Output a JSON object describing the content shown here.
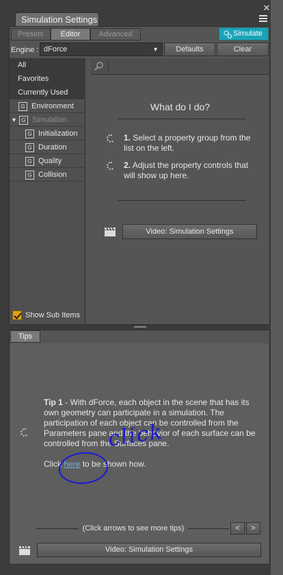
{
  "window": {
    "title": "Simulation Settings"
  },
  "tabs": [
    {
      "label": "Presets"
    },
    {
      "label": "Editor"
    },
    {
      "label": "Advanced"
    }
  ],
  "simulate_button": {
    "label": "Simulate"
  },
  "engine": {
    "label": "Engine :",
    "value": "dForce"
  },
  "buttons": {
    "defaults": "Defaults",
    "clear": "Clear"
  },
  "tree": {
    "all": "All",
    "favorites": "Favorites",
    "currently_used": "Currently Used",
    "items": [
      {
        "label": "Environment"
      },
      {
        "label": "Simulation"
      },
      {
        "label": "Initialization"
      },
      {
        "label": "Duration"
      },
      {
        "label": "Quality"
      },
      {
        "label": "Collision"
      }
    ],
    "show_sub_items": "Show Sub Items"
  },
  "help": {
    "heading": "What do I do?",
    "step1_num": "1.",
    "step1_text": "Select a property group from the list on the left.",
    "step2_num": "2.",
    "step2_text": "Adjust the property controls that will show up here.",
    "video_button": "Video: Simulation Settings"
  },
  "tips": {
    "tab_label": "Tips",
    "tip_title": "Tip 1",
    "tip_body": " - With dForce, each object in the scene that has its own geometry can participate in a simulation. The participation of each object can be controlled from the Parameters pane and the behavior of each surface can be controlled from the Surfaces pane.",
    "click_prefix": "Click",
    "click_link": "here",
    "click_suffix": "to be shown how.",
    "handwritten": "click",
    "nav_hint": "(Click arrows to see more tips)",
    "video_button": "Video: Simulation Settings"
  },
  "icons": {
    "close": "close-icon",
    "menu": "menu-icon",
    "simulate": "gears-icon",
    "search": "search-icon",
    "video": "clapper-icon",
    "spinner": "spinner-icon"
  },
  "colors": {
    "accent": "#1aa3b8",
    "link": "#6fb1e0",
    "annotation": "#1a1ad6"
  }
}
